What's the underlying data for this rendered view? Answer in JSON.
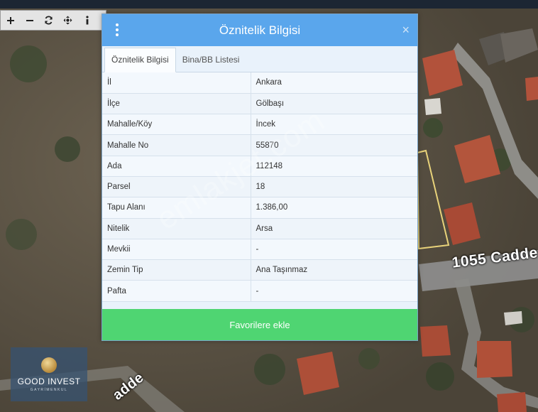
{
  "map": {
    "road_label_main": "1055 Cadde",
    "road_label_side": "adde",
    "watermark": "emlakjet.com",
    "toolbar": [
      {
        "name": "zoom-in-icon",
        "glyph": "+"
      },
      {
        "name": "zoom-out-icon",
        "glyph": "−"
      },
      {
        "name": "refresh-icon",
        "glyph": "refresh"
      },
      {
        "name": "move-icon",
        "glyph": "move"
      },
      {
        "name": "info-icon",
        "glyph": "i"
      }
    ]
  },
  "logo": {
    "text": "GOOD INVEST",
    "sub": "GAYRİMENKUL"
  },
  "dialog": {
    "title": "Öznitelik Bilgisi",
    "menu_icon": "kebab-menu-icon",
    "close_label": "×",
    "tabs": [
      {
        "label": "Öznitelik Bilgisi",
        "active": true
      },
      {
        "label": "Bina/BB Listesi",
        "active": false
      }
    ],
    "rows": [
      {
        "key": "İl",
        "value": "Ankara"
      },
      {
        "key": "İlçe",
        "value": "Gölbaşı"
      },
      {
        "key": "Mahalle/Köy",
        "value": "İncek"
      },
      {
        "key": "Mahalle No",
        "value": "55870"
      },
      {
        "key": "Ada",
        "value": "112148"
      },
      {
        "key": "Parsel",
        "value": "18"
      },
      {
        "key": "Tapu Alanı",
        "value": "1.386,00"
      },
      {
        "key": "Nitelik",
        "value": "Arsa"
      },
      {
        "key": "Mevkii",
        "value": "-"
      },
      {
        "key": "Zemin Tip",
        "value": "Ana Taşınmaz"
      },
      {
        "key": "Pafta",
        "value": "-"
      }
    ],
    "favorite_button": "Favorilere ekle"
  },
  "colors": {
    "header": "#5aa6ec",
    "favorite": "#4fd572",
    "dialog_bg": "#e9f2fb"
  }
}
